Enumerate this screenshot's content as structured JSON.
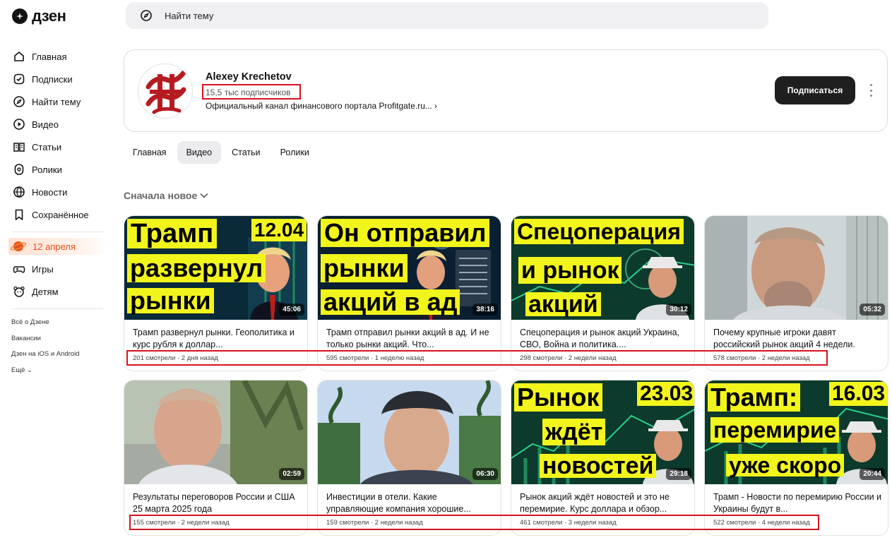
{
  "logo": {
    "text": "дзен"
  },
  "search": {
    "placeholder": "Найти тему"
  },
  "sidebar": {
    "items": [
      {
        "label": "Главная",
        "icon": "home-icon"
      },
      {
        "label": "Подписки",
        "icon": "subscriptions-icon"
      },
      {
        "label": "Найти тему",
        "icon": "compass-icon"
      },
      {
        "label": "Видео",
        "icon": "video-icon"
      },
      {
        "label": "Статьи",
        "icon": "book-icon"
      },
      {
        "label": "Ролики",
        "icon": "shorts-icon"
      },
      {
        "label": "Новости",
        "icon": "news-icon"
      },
      {
        "label": "Сохранённое",
        "icon": "bookmark-icon"
      }
    ],
    "promo": "12 апреля",
    "extra": [
      {
        "label": "Игры",
        "icon": "gamepad-icon"
      },
      {
        "label": "Детям",
        "icon": "kids-icon"
      }
    ],
    "footer": [
      "Всё о Дзене",
      "Вакансии",
      "Дзен на iOS и Android",
      "Ещё"
    ]
  },
  "channel": {
    "name": "Alexey Krechetov",
    "subscribers": "15,5 тыс подписчиков",
    "description": "Официальный канал финансового портала Profitgate.ru...",
    "subscribe_label": "Подписаться"
  },
  "tabs": [
    {
      "label": "Главная",
      "active": false
    },
    {
      "label": "Видео",
      "active": true
    },
    {
      "label": "Статьи",
      "active": false
    },
    {
      "label": "Ролики",
      "active": false
    }
  ],
  "sort_label": "Сначала новое",
  "accent_color": "#f2f51b",
  "highlight_color": "#d8121e",
  "videos": [
    {
      "title": "Трамп развернул рынки. Геополитика и курс рубля к доллар...",
      "views": "201 смотрели",
      "age": "2 дня назад",
      "duration": "45:06",
      "overlay": [
        "Трамп",
        "развернул",
        "рынки"
      ],
      "date_tag": "12.04"
    },
    {
      "title": "Трамп отправил рынки акций в ад. И не только рынки акций. Что...",
      "views": "595 смотрели",
      "age": "1 неделю назад",
      "duration": "38:16",
      "overlay": [
        "Он отправил",
        "рынки",
        "акций в ад"
      ],
      "date_tag": ""
    },
    {
      "title": "Спецоперация и рынок акций Украина, СВО, Война и политика....",
      "views": "298 смотрели",
      "age": "2 недели назад",
      "duration": "30:12",
      "overlay": [
        "Спецоперация",
        "и рынок",
        "акций"
      ],
      "date_tag": ""
    },
    {
      "title": "Почему крупные игроки давят российский рынок акций 4 недели.",
      "views": "578 смотрели",
      "age": "2 недели назад",
      "duration": "05:32",
      "overlay": [],
      "date_tag": ""
    },
    {
      "title": "Результаты переговоров России и США 25 марта 2025 года",
      "views": "155 смотрели",
      "age": "2 недели назад",
      "duration": "02:59",
      "overlay": [],
      "date_tag": ""
    },
    {
      "title": "Инвестиции в отели. Какие управляющие компания хорошие...",
      "views": "159 смотрели",
      "age": "2 недели назад",
      "duration": "06:30",
      "overlay": [],
      "date_tag": ""
    },
    {
      "title": "Рынок акций ждёт новостей и это не перемирие. Курс доллара и обзор...",
      "views": "461 смотрели",
      "age": "3 недели назад",
      "duration": "29:18",
      "overlay": [
        "Рынок",
        "ждёт",
        "новостей"
      ],
      "date_tag": "23.03"
    },
    {
      "title": "Трамп - Новости по перемирию России и Украины будут в...",
      "views": "522 смотрели",
      "age": "4 недели назад",
      "duration": "20:44",
      "overlay": [
        "Трамп:",
        "перемирие",
        "уже скоро"
      ],
      "date_tag": "16.03"
    }
  ]
}
